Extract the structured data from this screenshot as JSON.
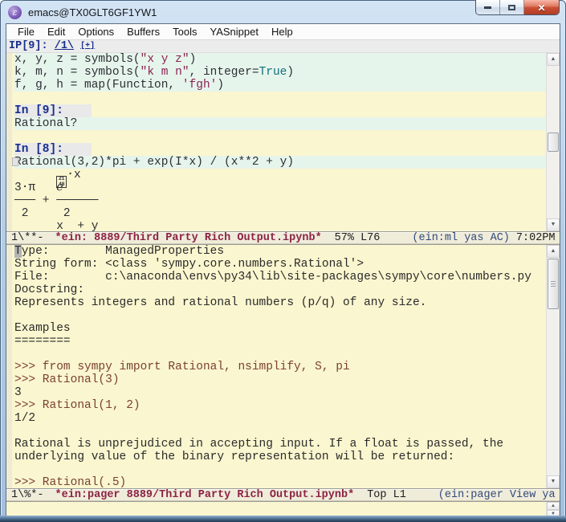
{
  "window": {
    "title": "emacs@TX0GLT6GF1YW1"
  },
  "icons": {
    "app": "ε",
    "close": "✕",
    "scroll_up": "▲",
    "scroll_down": "▼"
  },
  "colors": {
    "buffer_bg": "#faf6cf",
    "cell_bg": "#e6f5ec",
    "prompt_fg": "#182e8c",
    "modeline_bg": "#f0ecda",
    "buffer_name_fg": "#8b2345",
    "close_red": "#c94f33"
  },
  "menu_items": [
    "File",
    "Edit",
    "Options",
    "Buffers",
    "Tools",
    "YASnippet",
    "Help"
  ],
  "header_line": {
    "prompt": "IP[9]: ",
    "slider": "/1\\",
    "add": "[+]"
  },
  "top_window": {
    "hexbox": {
      "top": "21",
      "bottom": "48"
    },
    "lines": [
      {
        "bg": "cell",
        "name": "input-line",
        "segs": [
          [
            "x, y, z = symbols(",
            "code"
          ],
          [
            "\"x y z\"",
            "str"
          ],
          [
            ")",
            "code"
          ]
        ]
      },
      {
        "bg": "cell",
        "name": "input-line",
        "segs": [
          [
            "k, m, n = symbols(",
            "code"
          ],
          [
            "\"k m n\"",
            "str"
          ],
          [
            ", integer=",
            "code"
          ],
          [
            "True",
            "const"
          ],
          [
            ")",
            "code"
          ]
        ]
      },
      {
        "bg": "cell",
        "name": "input-line",
        "segs": [
          [
            "f, g, h = map(Function, ",
            "code"
          ],
          [
            "'fgh'",
            "str"
          ],
          [
            ")",
            "code"
          ]
        ]
      },
      {
        "bg": "plainbg",
        "name": "blank-line",
        "segs": []
      },
      {
        "bg": "promptline",
        "name": "cell-prompt",
        "prompt": "In [9]:"
      },
      {
        "bg": "cell",
        "name": "input-line",
        "segs": [
          [
            "Rational?",
            "code"
          ]
        ]
      },
      {
        "bg": "plainbg",
        "name": "blank-line",
        "segs": []
      },
      {
        "bg": "promptline",
        "name": "cell-prompt",
        "prompt": "In [8]:"
      },
      {
        "bg": "cell",
        "name": "input-line",
        "fringe_marker": true,
        "segs": [
          [
            "Rational(3,2)*pi + exp(I*x) / (x**2 + y)",
            "code"
          ]
        ]
      },
      {
        "bg": "plainbg",
        "name": "output-math-line",
        "segs": [
          [
            "      ",
            "code"
          ],
          [
            "",
            "hexbox"
          ],
          [
            "⋅x",
            "code"
          ]
        ]
      },
      {
        "bg": "plainbg",
        "name": "output-math-line",
        "segs": [
          [
            "3⋅π   ℯ",
            "code"
          ]
        ]
      },
      {
        "bg": "plainbg",
        "name": "output-math-line",
        "segs": [
          [
            "─── + ──────",
            "code"
          ]
        ]
      },
      {
        "bg": "plainbg",
        "name": "output-math-line",
        "segs": [
          [
            " 2     2",
            "code"
          ]
        ]
      },
      {
        "bg": "plainbg",
        "name": "output-math-line",
        "segs": [
          [
            "      x  + y",
            "code"
          ]
        ]
      }
    ]
  },
  "modeline_top": {
    "flags": "1\\**-",
    "buffer": "*ein: 8889/Third Party Rich Output.ipynb*",
    "position": "57% L76",
    "modes": "(ein:ml yas AC)",
    "time": "7:02PM"
  },
  "pager_window": {
    "lines": [
      {
        "face": "plain",
        "cursor": true,
        "text": "Type:        ManagedProperties"
      },
      {
        "face": "plain",
        "text": "String form: <class 'sympy.core.numbers.Rational'>"
      },
      {
        "face": "plain",
        "text": "File:        c:\\anaconda\\envs\\py34\\lib\\site-packages\\sympy\\core\\numbers.py"
      },
      {
        "face": "plain",
        "text": "Docstring:"
      },
      {
        "face": "plain",
        "text": "Represents integers and rational numbers (p/q) of any size."
      },
      {
        "face": "plain",
        "text": ""
      },
      {
        "face": "plain",
        "text": "Examples"
      },
      {
        "face": "plain",
        "text": "========"
      },
      {
        "face": "plain",
        "text": ""
      },
      {
        "face": "doctest",
        "text": ">>> from sympy import Rational, nsimplify, S, pi"
      },
      {
        "face": "doctest",
        "text": ">>> Rational(3)"
      },
      {
        "face": "plain",
        "text": "3"
      },
      {
        "face": "doctest",
        "text": ">>> Rational(1, 2)"
      },
      {
        "face": "plain",
        "text": "1/2"
      },
      {
        "face": "plain",
        "text": ""
      },
      {
        "face": "plain",
        "text": "Rational is unprejudiced in accepting input. If a float is passed, the"
      },
      {
        "face": "plain",
        "text": "underlying value of the binary representation will be returned:"
      },
      {
        "face": "plain",
        "text": ""
      },
      {
        "face": "doctest",
        "text": ">>> Rational(.5)"
      }
    ]
  },
  "modeline_bottom": {
    "flags": "1\\%*-",
    "buffer": "*ein:pager 8889/Third Party Rich Output.ipynb*",
    "position": "Top L1",
    "modes": "(ein:pager View ya"
  },
  "minibuffer": {
    "text": ""
  }
}
